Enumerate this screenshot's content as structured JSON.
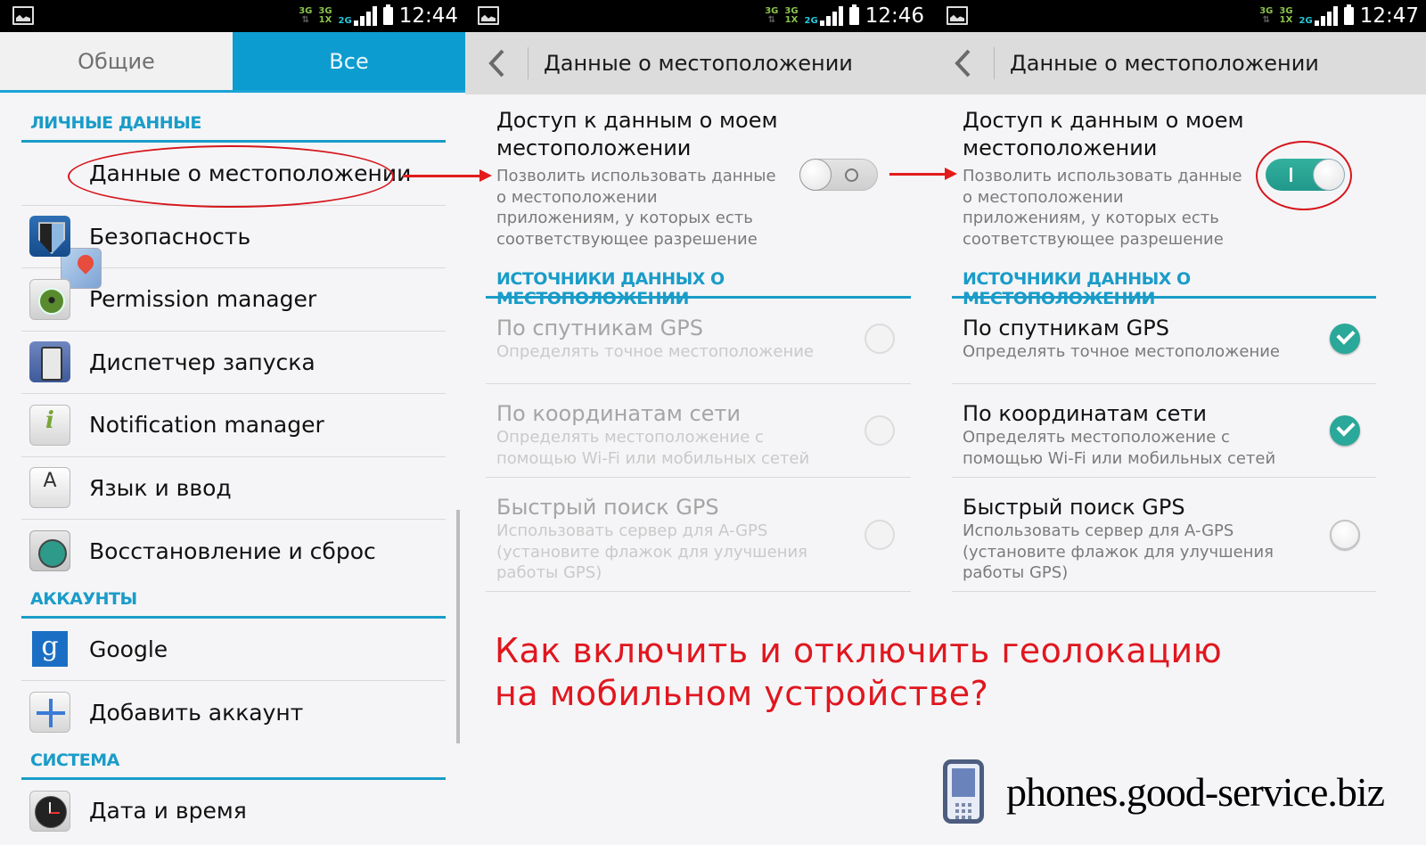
{
  "panels": [
    {
      "status_bar": {
        "time": "12:44",
        "net1": "3G",
        "net2_top": "3G",
        "net2_bottom": "1X",
        "net3": "2G"
      },
      "tabs": [
        {
          "label": "Общие",
          "active": false
        },
        {
          "label": "Все",
          "active": true
        }
      ],
      "sections": [
        {
          "title": "ЛИЧНЫЕ ДАННЫЕ",
          "items": [
            {
              "label": "Данные о местоположении",
              "icon": "location-icon",
              "highlighted": true
            },
            {
              "label": "Безопасность",
              "icon": "security-shield-icon"
            },
            {
              "label": "Permission manager",
              "icon": "permission-lock-icon"
            },
            {
              "label": "Диспетчер запуска",
              "icon": "launch-manager-icon"
            },
            {
              "label": "Notification manager",
              "icon": "notification-info-icon"
            },
            {
              "label": "Язык и ввод",
              "icon": "language-keyboard-icon",
              "glyph": "A"
            },
            {
              "label": "Восстановление и сброс",
              "icon": "backup-reset-icon"
            }
          ]
        },
        {
          "title": "АККАУНТЫ",
          "items": [
            {
              "label": "Google",
              "icon": "google-icon",
              "glyph": "g"
            },
            {
              "label": "Добавить аккаунт",
              "icon": "add-account-icon"
            }
          ]
        },
        {
          "title": "СИСТЕМА",
          "items": [
            {
              "label": "Дата и время",
              "icon": "clock-icon"
            }
          ]
        }
      ]
    },
    {
      "status_bar": {
        "time": "12:46",
        "net1": "3G",
        "net2_top": "3G",
        "net2_bottom": "1X",
        "net3": "2G"
      },
      "title": "Данные о местоположении",
      "access": {
        "title": "Доступ к данным о моем местоположении",
        "description": "Позволить использовать данные о местоположении приложениям, у которых есть соответствующее разрешение",
        "toggle_on": false
      },
      "sources_header": "ИСТОЧНИКИ ДАННЫХ О МЕСТОПОЛОЖЕНИИ",
      "sources": [
        {
          "title": "По спутникам GPS",
          "description": "Определять точное местоположение",
          "checked": false,
          "enabled": false
        },
        {
          "title": "По координатам сети",
          "description": "Определять местоположение с помощью Wi-Fi или мобильных сетей",
          "checked": false,
          "enabled": false
        },
        {
          "title": "Быстрый поиск GPS",
          "description": "Использовать сервер для A-GPS (установите флажок для улучшения работы GPS)",
          "checked": false,
          "enabled": false
        }
      ]
    },
    {
      "status_bar": {
        "time": "12:47",
        "net1": "3G",
        "net2_top": "3G",
        "net2_bottom": "1X",
        "net3": "2G"
      },
      "title": "Данные о местоположении",
      "access": {
        "title": "Доступ к данным о моем местоположении",
        "description": "Позволить использовать данные о местоположении приложениям, у которых есть соответствующее разрешение",
        "toggle_on": true
      },
      "sources_header": "ИСТОЧНИКИ ДАННЫХ О МЕСТОПОЛОЖЕНИИ",
      "sources": [
        {
          "title": "По спутникам GPS",
          "description": "Определять точное местоположение",
          "checked": true,
          "enabled": true
        },
        {
          "title": "По координатам сети",
          "description": "Определять местоположение с помощью Wi-Fi или мобильных сетей",
          "checked": true,
          "enabled": true
        },
        {
          "title": "Быстрый поиск GPS",
          "description": "Использовать сервер для A-GPS (установите флажок для улучшения работы GPS)",
          "checked": false,
          "enabled": true
        }
      ]
    }
  ],
  "overlay": {
    "caption_line1": "Как включить и отключить геолокацию",
    "caption_line2": "на мобильном устройстве?",
    "brand": "phones.good-service.biz",
    "annotation_color": "#e31b1b"
  },
  "colors": {
    "accent": "#1a9cc8",
    "tab_active": "#0d9ccf",
    "toggle_on": "#2aa899",
    "caption": "#e0171f"
  }
}
